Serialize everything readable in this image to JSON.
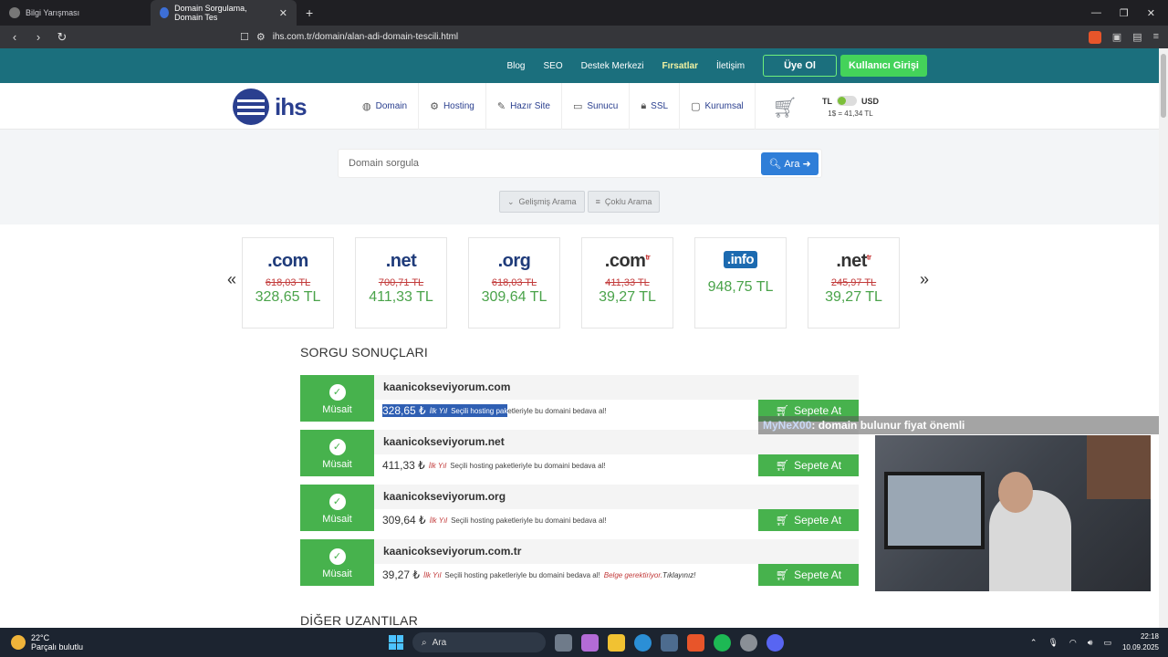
{
  "browser": {
    "tabs": [
      {
        "label": "Bilgi Yarışması",
        "active": false
      },
      {
        "label": "Domain Sorgulama, Domain Tes",
        "active": true
      }
    ],
    "url": "ihs.com.tr/domain/alan-adi-domain-tescili.html"
  },
  "topbar": {
    "links": [
      "Blog",
      "SEO",
      "Destek Merkezi",
      "Fırsatlar",
      "İletişim"
    ],
    "signup": "Üye Ol",
    "login": "Kullanıcı Girişi"
  },
  "header": {
    "logo": "ihs",
    "nav": [
      "Domain",
      "Hosting",
      "Hazır Site",
      "Sunucu",
      "SSL",
      "Kurumsal"
    ],
    "currency": {
      "left": "TL",
      "right": "USD",
      "rate": "1$ = 41,34 TL"
    }
  },
  "search": {
    "placeholder": "Domain sorgula",
    "button": "Ara",
    "advanced": "Gelişmiş Arama",
    "multi": "Çoklu Arama"
  },
  "tlds": [
    {
      "name": ".com",
      "old": "618,03 TL",
      "price": "328,65 TL"
    },
    {
      "name": ".net",
      "old": "700,71 TL",
      "price": "411,33 TL"
    },
    {
      "name": ".org",
      "old": "618,03 TL",
      "price": "309,64 TL"
    },
    {
      "name": ".com",
      "sup": "tr",
      "old": "411,33 TL",
      "price": "39,27 TL"
    },
    {
      "name": ".info",
      "old": "",
      "price": "948,75 TL"
    },
    {
      "name": ".net",
      "sup": "tr",
      "old": "245,97 TL",
      "price": "39,27 TL"
    }
  ],
  "results": {
    "title": "SORGU SONUÇLARI",
    "status": "Müsait",
    "first_year": "İlk Yıl",
    "cart_button": "Sepete At",
    "items": [
      {
        "domain": "kaanicokseviyorum.com",
        "price": "328,65 ₺",
        "desc_sel": "Seçili hosting pak",
        "desc": "etleriyle bu domaini bedava al!"
      },
      {
        "domain": "kaanicokseviyorum.net",
        "price": "411,33 ₺",
        "desc": "Seçili hosting paketleriyle bu domaini bedava al!"
      },
      {
        "domain": "kaanicokseviyorum.org",
        "price": "309,64 ₺",
        "desc": "Seçili hosting paketleriyle bu domaini bedava al!"
      },
      {
        "domain": "kaanicokseviyorum.com.tr",
        "price": "39,27 ₺",
        "desc": "Seçili hosting paketleriyle bu domaini bedava al!",
        "warn": "Belge gerektiriyor.",
        "click": "Tıklayınız!"
      }
    ]
  },
  "other_title": "DİĞER UZANTILAR",
  "chat": {
    "user": "MyNeX00",
    "message": ": domain bulunur fiyat önemli"
  },
  "taskbar": {
    "temp": "22°C",
    "weather": "Parçalı bulutlu",
    "search": "Ara",
    "time": "22:18",
    "date": "10.09.2025"
  }
}
